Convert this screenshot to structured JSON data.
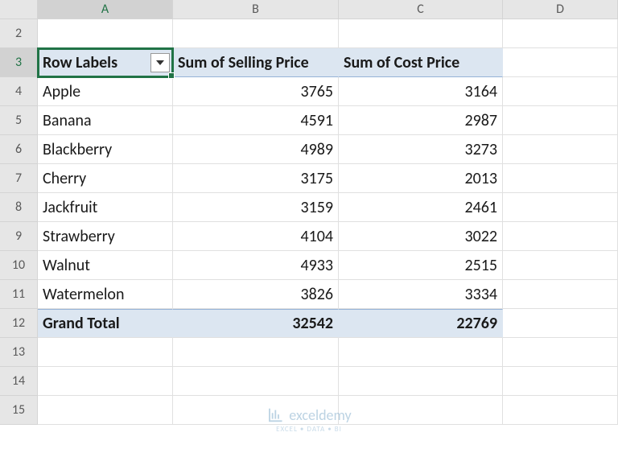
{
  "columns": [
    "A",
    "B",
    "C",
    "D"
  ],
  "visible_row_numbers": [
    2,
    3,
    4,
    5,
    6,
    7,
    8,
    9,
    10,
    11,
    12,
    13,
    14,
    15
  ],
  "active_cell": "A3",
  "pivot": {
    "headers": {
      "row_labels": "Row Labels",
      "col_b": "Sum of Selling Price",
      "col_c": "Sum of Cost Price"
    },
    "rows": [
      {
        "label": "Apple",
        "selling": "3765",
        "cost": "3164"
      },
      {
        "label": "Banana",
        "selling": "4591",
        "cost": "2987"
      },
      {
        "label": "Blackberry",
        "selling": "4989",
        "cost": "3273"
      },
      {
        "label": "Cherry",
        "selling": "3175",
        "cost": "2013"
      },
      {
        "label": "Jackfruit",
        "selling": "3159",
        "cost": "2461"
      },
      {
        "label": "Strawberry",
        "selling": "4104",
        "cost": "3022"
      },
      {
        "label": "Walnut",
        "selling": "4933",
        "cost": "2515"
      },
      {
        "label": "Watermelon",
        "selling": "3826",
        "cost": "3334"
      }
    ],
    "grand_total": {
      "label": "Grand Total",
      "selling": "32542",
      "cost": "22769"
    }
  },
  "watermark": {
    "text": "exceldemy",
    "sub": "EXCEL • DATA • BI"
  }
}
